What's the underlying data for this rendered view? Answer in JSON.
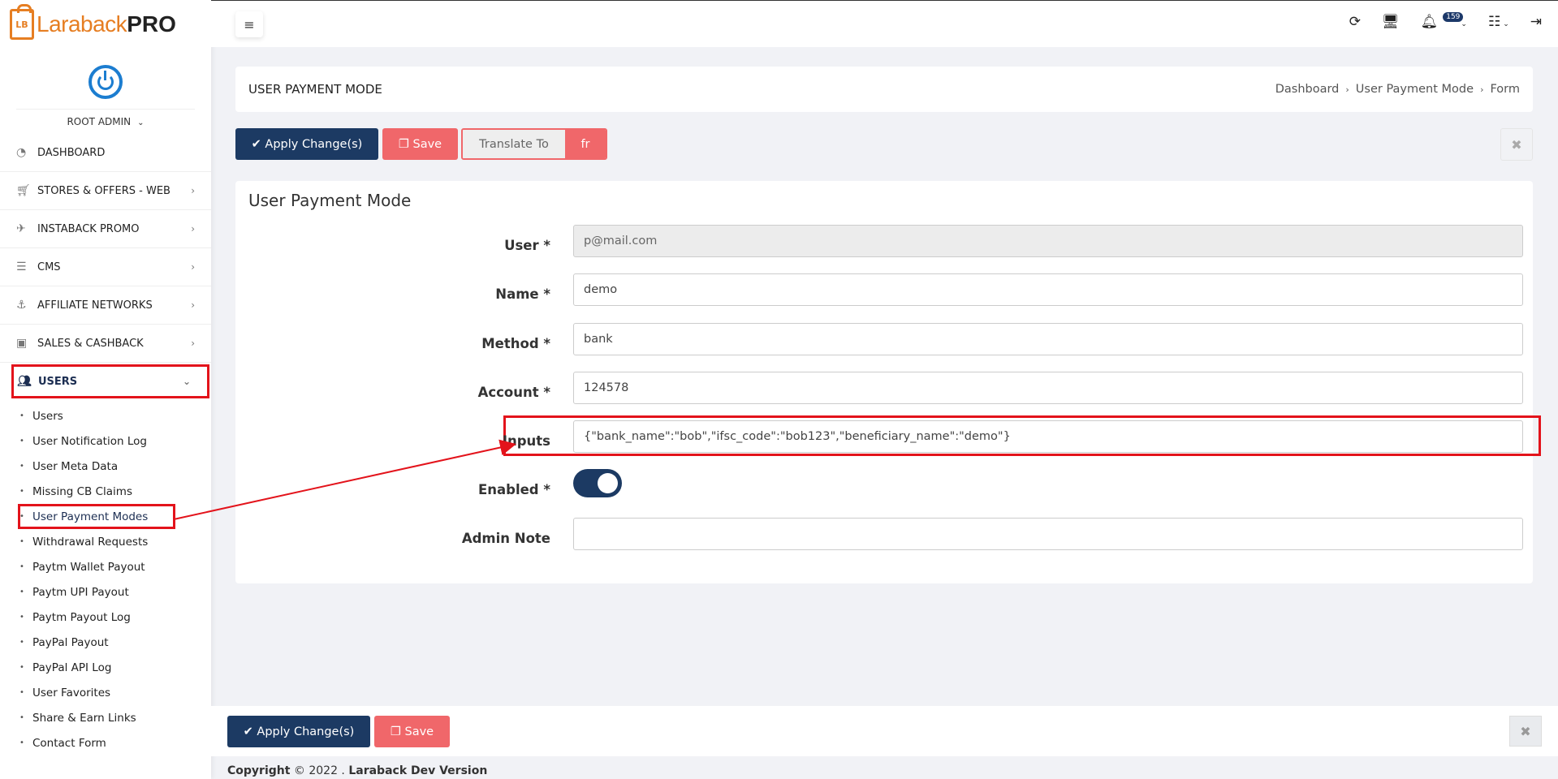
{
  "brand": {
    "logo_mark": "LB",
    "name_part1": "Laraback",
    "name_part2": "PRO"
  },
  "user": {
    "name": "ROOT ADMIN"
  },
  "nav": [
    {
      "label": "DASHBOARD",
      "icon": "dashboard-icon"
    },
    {
      "label": "STORES & OFFERS - WEB",
      "icon": "cart-icon"
    },
    {
      "label": "INSTABACK PROMO",
      "icon": "plane-icon"
    },
    {
      "label": "CMS",
      "icon": "list-icon"
    },
    {
      "label": "AFFILIATE NETWORKS",
      "icon": "anchor-icon"
    },
    {
      "label": "SALES & CASHBACK",
      "icon": "money-icon"
    },
    {
      "label": "USERS",
      "icon": "users-icon"
    }
  ],
  "subnav": [
    "Users",
    "User Notification Log",
    "User Meta Data",
    "Missing CB Claims",
    "User Payment Modes",
    "Withdrawal Requests",
    "Paytm Wallet Payout",
    "Paytm UPI Payout",
    "Paytm Payout Log",
    "PayPal Payout",
    "PayPal API Log",
    "User Favorites",
    "Share & Earn Links",
    "Contact Form"
  ],
  "topbar": {
    "notification_count": "159"
  },
  "header": {
    "title": "USER PAYMENT MODE",
    "breadcrumbs": [
      "Dashboard",
      "User Payment Mode",
      "Form"
    ]
  },
  "actions": {
    "apply_label": "Apply Change(s)",
    "save_label": "Save",
    "translate_label": "Translate To",
    "translate_lang": "fr"
  },
  "form": {
    "title": "User Payment Mode",
    "fields": [
      {
        "label": "User *",
        "value": "p@mail.com"
      },
      {
        "label": "Name *",
        "value": "demo"
      },
      {
        "label": "Method *",
        "value": "bank"
      },
      {
        "label": "Account *",
        "value": "124578"
      },
      {
        "label": "Inputs",
        "value": "{\"bank_name\":\"bob\",\"ifsc_code\":\"bob123\",\"beneficiary_name\":\"demo\"}"
      },
      {
        "label": "Enabled *",
        "value": ""
      },
      {
        "label": "Admin Note",
        "value": ""
      }
    ]
  },
  "footer": {
    "copyright_prefix": "Copyright",
    "copyright_year": "© 2022 .",
    "copyright_name": "Laraback Dev Version"
  },
  "colors": {
    "primary": "#1c3a63",
    "danger": "#f0676a",
    "annotation": "#e3131b",
    "brand": "#e67e22"
  }
}
